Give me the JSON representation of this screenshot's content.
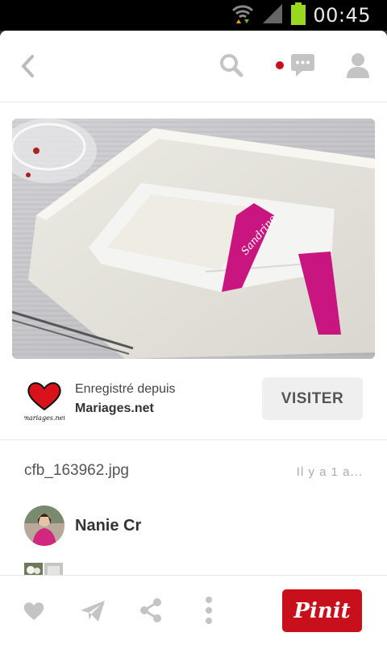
{
  "status_bar": {
    "time": "00:45"
  },
  "source": {
    "saved_from_label": "Enregistré depuis",
    "site_name": "Mariages.net",
    "logo_text": "mariages.net",
    "visit_label": "VISITER"
  },
  "pin": {
    "filename": "cfb_163962.jpg",
    "time_ago": "Il y a 1 a..."
  },
  "user": {
    "name": "Nanie Cr"
  },
  "actions": {
    "pin_it_label": "Pinit"
  },
  "colors": {
    "brand_red": "#c8101c",
    "notification_dot": "#c8101c"
  }
}
